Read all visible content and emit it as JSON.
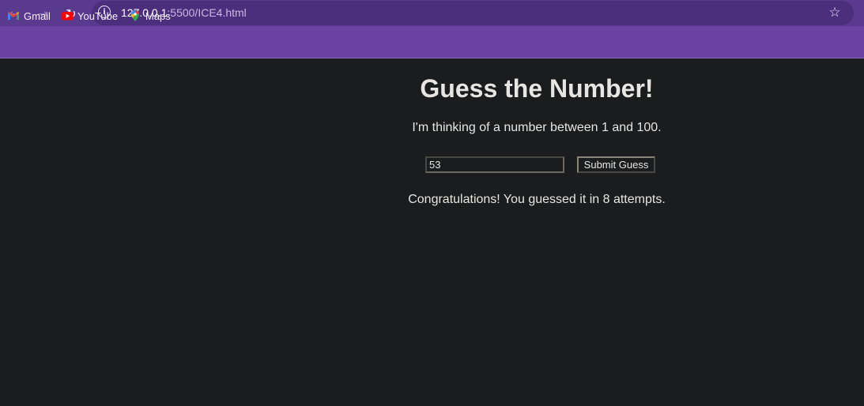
{
  "browser": {
    "url_host": "127.0.0.1",
    "url_path": ":5500/ICE4.html",
    "bookmarks": [
      {
        "label": "Gmail",
        "icon": "gmail-icon"
      },
      {
        "label": "YouTube",
        "icon": "youtube-icon"
      },
      {
        "label": "Maps",
        "icon": "maps-icon"
      }
    ],
    "theme_color": "#6b41a3"
  },
  "game": {
    "title": "Guess the Number!",
    "instructions": "I'm thinking of a number between 1 and 100.",
    "guess_value": "53",
    "submit_label": "Submit Guess",
    "result": "Congratulations! You guessed it in 8 attempts."
  }
}
